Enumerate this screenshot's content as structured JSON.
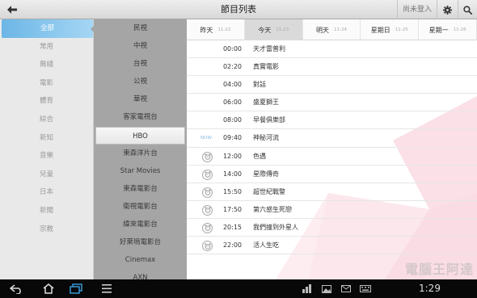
{
  "header": {
    "title": "節目列表",
    "login_label": "尚未登入"
  },
  "categories": [
    {
      "label": "全部",
      "active": true
    },
    {
      "label": "常用"
    },
    {
      "label": "無綫"
    },
    {
      "label": "電影"
    },
    {
      "label": "體育"
    },
    {
      "label": "綜合"
    },
    {
      "label": "新知"
    },
    {
      "label": "音樂"
    },
    {
      "label": "兒童"
    },
    {
      "label": "日本"
    },
    {
      "label": "新聞"
    },
    {
      "label": "宗教"
    }
  ],
  "channels": [
    {
      "label": "民視"
    },
    {
      "label": "中視"
    },
    {
      "label": "台視"
    },
    {
      "label": "公視"
    },
    {
      "label": "華視"
    },
    {
      "label": "客家電視台"
    },
    {
      "label": "HBO",
      "active": true
    },
    {
      "label": "東森洋片台"
    },
    {
      "label": "Star Movies"
    },
    {
      "label": "東森電影台"
    },
    {
      "label": "衛視電影台"
    },
    {
      "label": "緯來電影台"
    },
    {
      "label": "好萊塢電影台"
    },
    {
      "label": "Cinemax"
    },
    {
      "label": "AXN"
    }
  ],
  "days": [
    {
      "label": "昨天",
      "date": "11-22"
    },
    {
      "label": "今天",
      "date": "11-23",
      "active": true
    },
    {
      "label": "明天",
      "date": "11-24"
    },
    {
      "label": "星期日",
      "date": "11-25"
    },
    {
      "label": "星期一",
      "date": "11-26"
    }
  ],
  "programs": [
    {
      "time": "00:00",
      "title": "天才雷普利",
      "marker": "none"
    },
    {
      "time": "02:20",
      "title": "真實電影",
      "marker": "none"
    },
    {
      "time": "04:00",
      "title": "對話",
      "marker": "none"
    },
    {
      "time": "06:00",
      "title": "盛夏獅王",
      "marker": "none"
    },
    {
      "time": "08:00",
      "title": "早餐俱樂部",
      "marker": "none"
    },
    {
      "time": "09:40",
      "title": "神秘河流",
      "marker": "now",
      "flag": "NOW"
    },
    {
      "time": "12:00",
      "title": "色遇",
      "marker": "alarm"
    },
    {
      "time": "14:00",
      "title": "星際傳奇",
      "marker": "alarm"
    },
    {
      "time": "15:50",
      "title": "超世紀戰警",
      "marker": "alarm"
    },
    {
      "time": "17:50",
      "title": "第六感生死戀",
      "marker": "alarm"
    },
    {
      "time": "20:15",
      "title": "我們撞到外星人",
      "marker": "alarm"
    },
    {
      "time": "22:00",
      "title": "活人生吃",
      "marker": "alarm"
    }
  ],
  "statusbar": {
    "time": "1:29"
  },
  "watermark": "電腦王阿達",
  "colors": {
    "accent_blue": "#6cb6e6",
    "now_flag": "#8ab8e0",
    "navbar": "#080808"
  }
}
